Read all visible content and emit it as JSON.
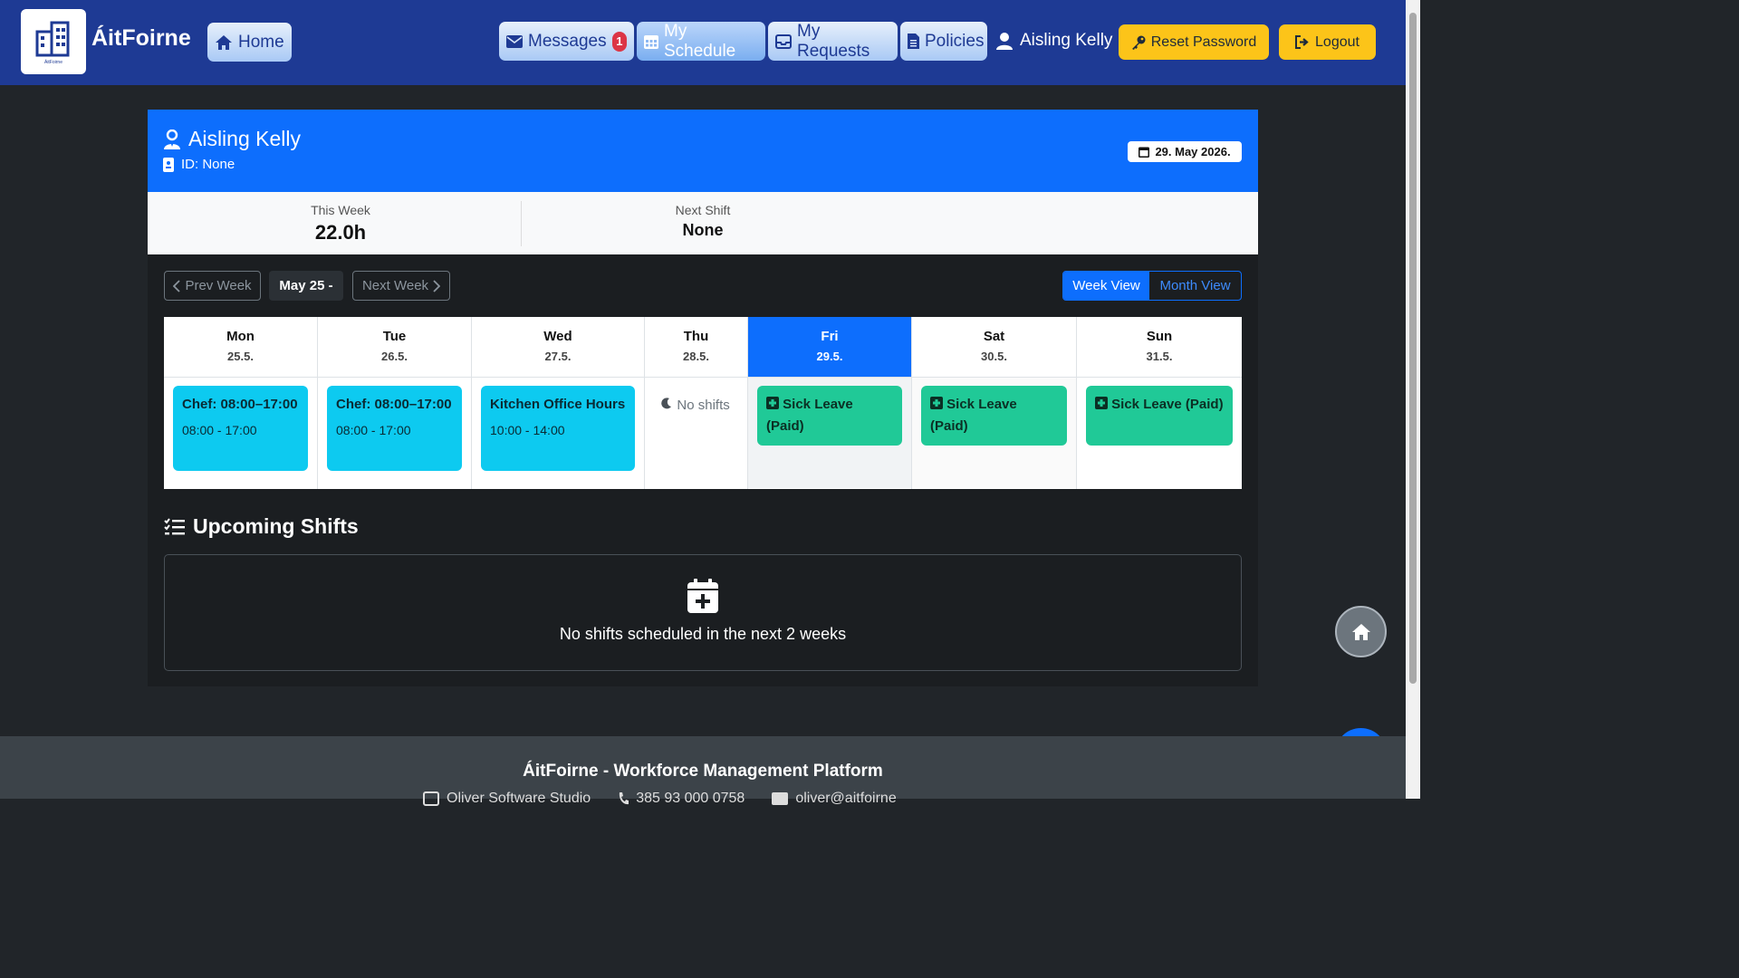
{
  "nav": {
    "brand": "ÁitFoirne",
    "logo_sub": "ÁitFoirne",
    "home": "Home",
    "messages": "Messages",
    "messages_badge": "1",
    "my_schedule": "My Schedule",
    "my_requests": "My Requests",
    "policies": "Policies",
    "user": "Aisling Kelly",
    "reset_password": "Reset Password",
    "logout": "Logout"
  },
  "employee": {
    "name": "Aisling Kelly",
    "id": "ID: None",
    "date": "29. May 2026."
  },
  "stats": {
    "this_week_label": "This Week",
    "this_week_value": "22.0h",
    "next_shift_label": "Next Shift",
    "next_shift_value": "None"
  },
  "week_nav": {
    "prev": "Prev Week",
    "current": "May 25 -",
    "next": "Next Week",
    "week_view": "Week View",
    "month_view": "Month View"
  },
  "days": [
    {
      "name": "Mon",
      "date": "25.5.",
      "shift_title": "Chef: 08:00–17:00",
      "shift_time": "08:00 - 17:00"
    },
    {
      "name": "Tue",
      "date": "26.5.",
      "shift_title": "Chef: 08:00–17:00",
      "shift_time": "08:00 - 17:00"
    },
    {
      "name": "Wed",
      "date": "27.5.",
      "shift_title": "Kitchen Office Hours",
      "shift_time": "10:00 - 14:00"
    },
    {
      "name": "Thu",
      "date": "28.5.",
      "no_shift": "No shifts"
    },
    {
      "name": "Fri",
      "date": "29.5.",
      "leave": "Sick Leave (Paid)"
    },
    {
      "name": "Sat",
      "date": "30.5.",
      "leave": "Sick Leave (Paid)"
    },
    {
      "name": "Sun",
      "date": "31.5.",
      "leave": "Sick Leave (Paid)"
    }
  ],
  "upcoming": {
    "title": "Upcoming Shifts",
    "empty": "No shifts scheduled in the next 2 weeks"
  },
  "footer": {
    "title": "ÁitFoirne - Workforce Management Platform",
    "company": "Oliver Software Studio",
    "phone": "385 93 000 0758",
    "email": "oliver@aitfoirne"
  },
  "colors": {
    "navbar": "#1e3a94",
    "primary": "#0d6efd",
    "shift": "#0dcaf0",
    "leave": "#20c997",
    "warning": "#fcc419"
  }
}
